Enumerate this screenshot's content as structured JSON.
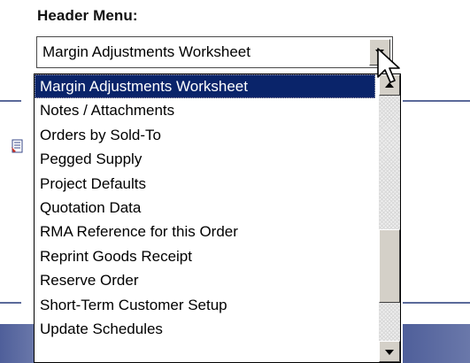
{
  "header": {
    "label": "Header Menu:"
  },
  "combo": {
    "value": "Margin Adjustments Worksheet",
    "button_icon": "chevron-down-icon"
  },
  "dropdown": {
    "items": [
      {
        "label": "Margin Adjustments Worksheet",
        "selected": true
      },
      {
        "label": "Notes / Attachments",
        "selected": false
      },
      {
        "label": "Orders by Sold-To",
        "selected": false
      },
      {
        "label": "Pegged Supply",
        "selected": false
      },
      {
        "label": "Project Defaults",
        "selected": false
      },
      {
        "label": "Quotation Data",
        "selected": false
      },
      {
        "label": "RMA Reference for this Order",
        "selected": false
      },
      {
        "label": "Reprint Goods Receipt",
        "selected": false
      },
      {
        "label": "Reserve Order",
        "selected": false
      },
      {
        "label": "Short-Term Customer Setup",
        "selected": false
      },
      {
        "label": "Update Schedules",
        "selected": false
      }
    ],
    "scroll_position": 0.78,
    "visible_fraction": 0.3
  },
  "background": {
    "page_icon": "report-icon"
  },
  "colors": {
    "selection": "#0a246a",
    "accent_bar": "#4f5f9a",
    "button_face": "#d4d0c8"
  }
}
